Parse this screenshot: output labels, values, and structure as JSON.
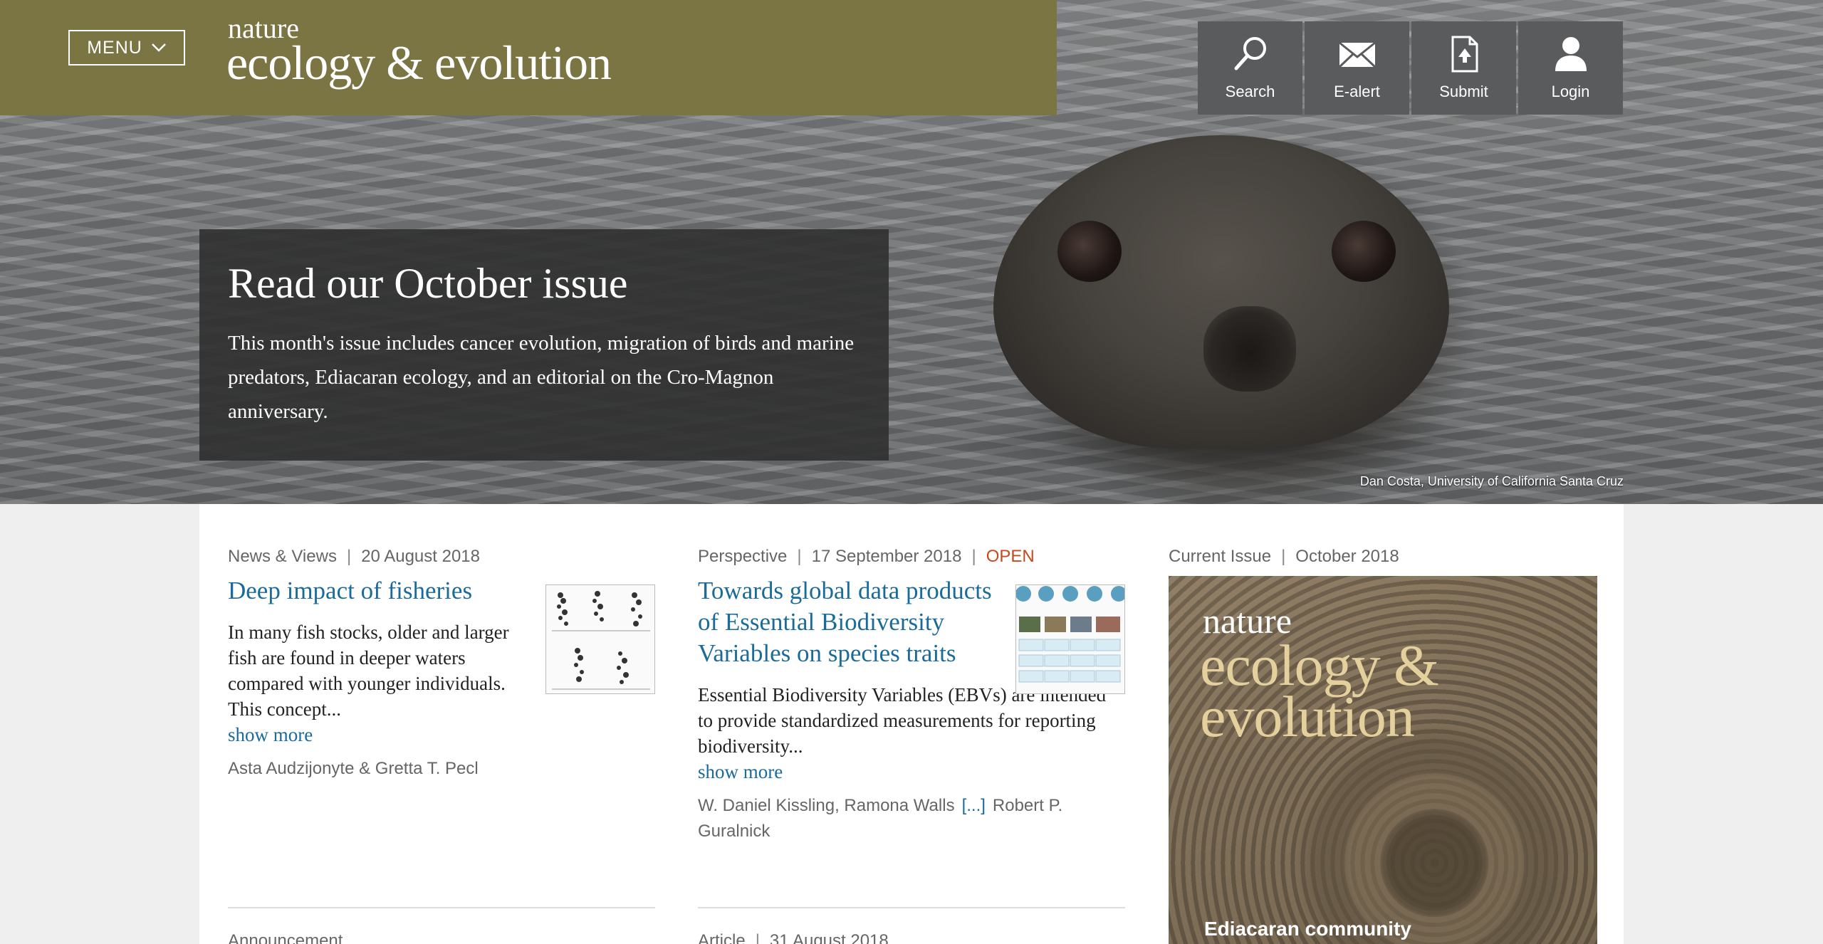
{
  "header": {
    "menu_label": "MENU",
    "logo_small": "nature",
    "logo_big": "ecology & evolution",
    "band_color": "#7b7443",
    "tools": [
      {
        "label": "Search",
        "icon": "search-icon"
      },
      {
        "label": "E-alert",
        "icon": "envelope-icon"
      },
      {
        "label": "Submit",
        "icon": "upload-document-icon"
      },
      {
        "label": "Login",
        "icon": "user-icon"
      }
    ]
  },
  "hero": {
    "title": "Read our October issue",
    "description": "This month's issue includes cancer evolution, migration of birds and marine predators, Ediacaran ecology, and an editorial on the Cro-Magnon anniversary.",
    "credit": "Dan Costa, University of California Santa Cruz"
  },
  "cards": [
    {
      "type": "News & Views",
      "date": "20 August 2018",
      "title": "Deep impact of fisheries",
      "summary": "In many fish stocks, older and larger fish are found in deeper waters compared with younger individuals. This concept...",
      "show_more": "show more",
      "authors": "Asta Audzijonyte & Gretta T. Pecl"
    },
    {
      "type": "Perspective",
      "date": "17 September 2018",
      "badge": "OPEN",
      "title": "Towards global data products of Essential Biodiversity Variables on species traits",
      "summary": "Essential Biodiversity Variables (EBVs) are intended to provide standardized measurements for reporting biodiversity...",
      "show_more": "show more",
      "authors_first": "W. Daniel Kissling, Ramona Walls",
      "authors_ellipsis": "[...]",
      "authors_last": "Robert P. Guralnick"
    }
  ],
  "current_issue": {
    "label": "Current Issue",
    "date": "October 2018",
    "cover_nature": "nature",
    "cover_title_line1": "ecology &",
    "cover_title_line2": "evolution",
    "cover_caption": "Ediacaran community"
  },
  "next_row": {
    "left": "Announcement",
    "middle_type": "Article",
    "middle_date": "31 August 2018"
  },
  "colors": {
    "link": "#1a6b9a",
    "open_badge": "#c8471c",
    "tool_bg": "#5a5b5d"
  }
}
